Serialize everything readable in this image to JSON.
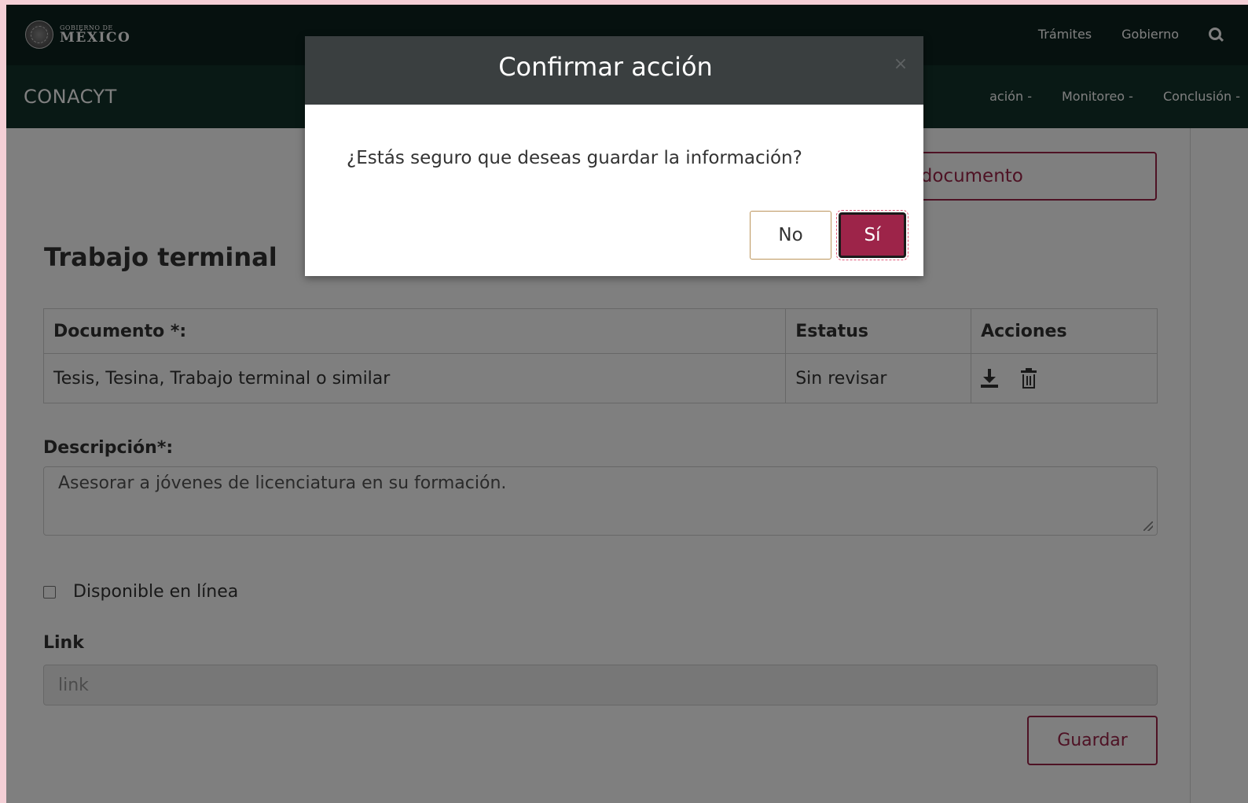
{
  "gov_header": {
    "logo_small": "GOBIERNO DE",
    "logo_big": "MÉXICO",
    "links": [
      "Trámites",
      "Gobierno"
    ],
    "search_icon": "search-icon"
  },
  "nav": {
    "brand": "CONACYT",
    "items": [
      {
        "label": "ación -"
      },
      {
        "label": "Monitoreo -"
      },
      {
        "label": "Conclusión -"
      }
    ]
  },
  "page": {
    "upload_button": "bir documento",
    "section_title": "Trabajo terminal",
    "table": {
      "headers": [
        "Documento *:",
        "Estatus",
        "Acciones"
      ],
      "rows": [
        {
          "documento": "Tesis, Tesina, Trabajo terminal o similar",
          "estatus": "Sin revisar"
        }
      ],
      "action_icons": [
        "download-icon",
        "trash-icon"
      ]
    },
    "descripcion_label": "Descripción*:",
    "descripcion_value": "Asesorar a jóvenes de licenciatura en su formación.",
    "disponible_label": "Disponible en línea",
    "link_label": "Link",
    "link_placeholder": "link",
    "save_button": "Guardar"
  },
  "modal": {
    "title": "Confirmar acción",
    "close_icon": "×",
    "message": "¿Estás seguro que deseas guardar la información?",
    "no_label": "No",
    "yes_label": "Sí"
  },
  "colors": {
    "gov_bar": "#0c231e",
    "nav_bar": "#13322b",
    "accent": "#9d2449",
    "gold": "#bc955c",
    "modal_header": "#3a3f40"
  }
}
